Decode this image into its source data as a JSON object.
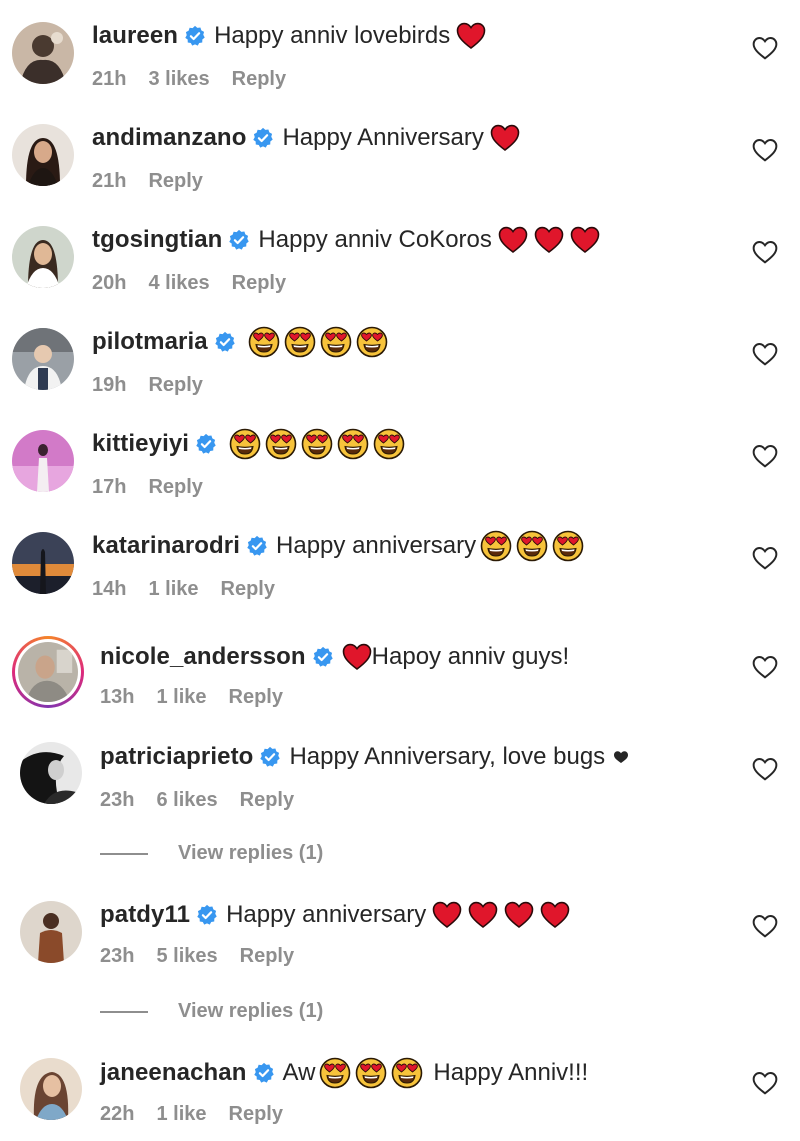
{
  "comments": [
    {
      "username": "laureen",
      "text": "Happy anniv lovebirds",
      "time": "21h",
      "likes": "3 likes",
      "reply": "Reply"
    },
    {
      "username": "andimanzano",
      "text": "Happy Anniversary",
      "time": "21h",
      "likes": "",
      "reply": "Reply"
    },
    {
      "username": "tgosingtian",
      "text": "Happy anniv CoKoros",
      "time": "20h",
      "likes": "4 likes",
      "reply": "Reply"
    },
    {
      "username": "pilotmaria",
      "text": "",
      "time": "19h",
      "likes": "",
      "reply": "Reply"
    },
    {
      "username": "kittieyiyi",
      "text": "",
      "time": "17h",
      "likes": "",
      "reply": "Reply"
    },
    {
      "username": "katarinarodri",
      "text": "Happy anniversary",
      "time": "14h",
      "likes": "1 like",
      "reply": "Reply"
    },
    {
      "username": "nicole_andersson",
      "text": "Hapoy anniv guys!",
      "time": "13h",
      "likes": "1 like",
      "reply": "Reply"
    },
    {
      "username": "patriciaprieto",
      "text": "Happy Anniversary, love bugs",
      "time": "23h",
      "likes": "6 likes",
      "reply": "Reply",
      "view_replies": "View replies (1)"
    },
    {
      "username": "patdy11",
      "text": "Happy anniversary",
      "time": "23h",
      "likes": "5 likes",
      "reply": "Reply",
      "view_replies": "View replies (1)"
    },
    {
      "username": "janeenachan",
      "text_before": "Aw",
      "text_after": "Happy Anniv!!!",
      "time": "22h",
      "likes": "1 like",
      "reply": "Reply"
    }
  ],
  "icons": {
    "verified": "verified-badge-icon",
    "like": "heart-outline-icon",
    "red_heart": "red-heart-emoji",
    "heart_eyes": "heart-eyes-emoji"
  },
  "colors": {
    "verified": "#3897f0",
    "text": "#262626",
    "meta": "#8e8e8e",
    "heart": "#e0162b"
  }
}
